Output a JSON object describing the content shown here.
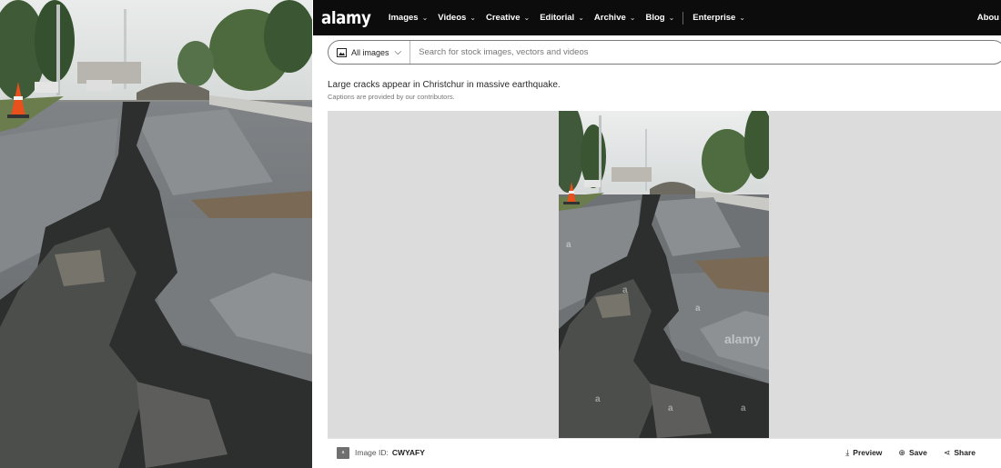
{
  "brand": {
    "logo": "alamy"
  },
  "nav": {
    "items": [
      {
        "label": "Images",
        "chevron": "⌄"
      },
      {
        "label": "Videos",
        "chevron": "⌄"
      },
      {
        "label": "Creative",
        "chevron": "⌄"
      },
      {
        "label": "Editorial",
        "chevron": "⌄"
      },
      {
        "label": "Archive",
        "chevron": "⌄"
      },
      {
        "label": "Blog",
        "chevron": "⌄"
      }
    ],
    "enterprise": {
      "label": "Enterprise",
      "chevron": "⌄"
    },
    "right_label": "Abou"
  },
  "search": {
    "scope_label": "All images",
    "scope_chevron": "⌵",
    "placeholder": "Search for stock images, vectors and videos"
  },
  "image": {
    "caption": "Large cracks appear in Christchur in massive earthquake.",
    "caption_note": "Captions are provided by our contributors.",
    "watermark": "alamy"
  },
  "footer": {
    "badge": "a",
    "id_label": "Image ID:",
    "id_value": "CWYAFY",
    "actions": [
      {
        "icon": "download-icon",
        "glyph": "⤓",
        "label": "Preview"
      },
      {
        "icon": "plus-circle-icon",
        "glyph": "⊕",
        "label": "Save"
      },
      {
        "icon": "share-icon",
        "glyph": "⋖",
        "label": "Share"
      }
    ]
  },
  "colors": {
    "nav_bg": "#0c0c0c",
    "viewer_bg": "#dcdcdc",
    "cone": "#e8501c"
  }
}
